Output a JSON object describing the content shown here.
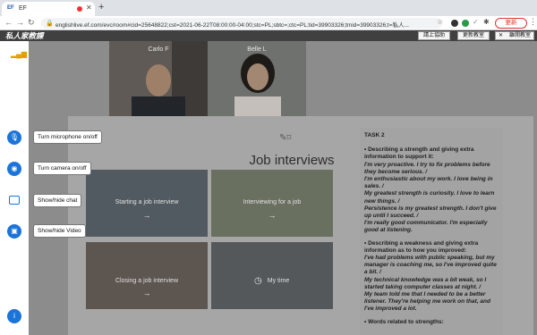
{
  "browser": {
    "tab_title": "EF",
    "tab_favicon": "EF",
    "url": "englishlive.ef.com/evc/room#cid=25648822;cst=2021-06-22T08:00:00-04:00;stc=PL;sbtc=;ctc=PL;tid=39903326;tmid=39903326;t=私人...",
    "update_label": "更新",
    "icons": [
      "back-icon",
      "forward-icon",
      "reload-icon",
      "lock-icon",
      "star-icon",
      "extension-icon",
      "puzzle-icon",
      "profile-icon",
      "menu-icon"
    ]
  },
  "app": {
    "logo": "私人家教課",
    "buttons": [
      "請上協助",
      "更新教室",
      "離開教室"
    ],
    "close_glyph": "✕"
  },
  "videos": [
    {
      "name": "Carlo F"
    },
    {
      "name": "Belle L"
    }
  ],
  "sidebar": {
    "icons": [
      "signal-icon",
      "microphone-icon",
      "camera-icon",
      "chat-icon",
      "video-icon",
      "info-icon"
    ]
  },
  "tooltips": {
    "microphone": "Turn microphone on/off",
    "camera": "Turn camera on/off",
    "chat": "Show/hide chat",
    "video": "Show/hide Video"
  },
  "slide": {
    "title": "Job interviews",
    "tiles": [
      "Starting a job interview",
      "Interviewing for a job",
      "Closing a job interview",
      "My time"
    ]
  },
  "task": {
    "title": "TASK 2",
    "lines": [
      "• Describing a strength and giving extra information to support it:",
      "I'm very proactive. I try to fix problems before they become serious. /",
      "I'm enthusiastic about my work. I love being in sales. /",
      "My greatest strength is curiosity. I love to learn new things. /",
      "Persistence is my greatest strength. I don't give up until I succeed. /",
      "I'm really good communicator. I'm especially good at listening.",
      "",
      "• Describing a weakness and giving extra information as to how you improved:",
      "I've had problems with public speaking, but my manager is coaching me, so I've improved quite a bit. /",
      "My technical knowledge was a bit weak, so I started taking computer classes at night. /",
      "My team told me that I needed to be a better listener. They're helping me work on that, and I've improved a lot.",
      "",
      "• Words related to strengths:"
    ]
  },
  "colors": {
    "accent": "#1d74d8",
    "overlay": "#8c8c8c",
    "header": "#404040"
  }
}
